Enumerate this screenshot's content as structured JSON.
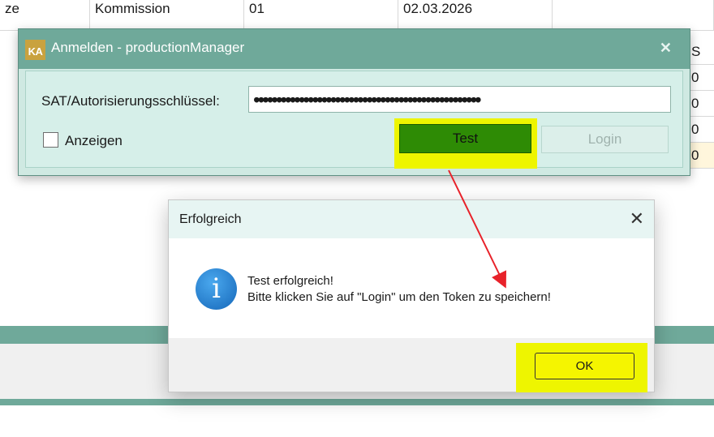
{
  "background_table": {
    "top_row": [
      "ze",
      "Kommission",
      "01",
      "02.03.2026",
      ""
    ],
    "side_cells": [
      "S",
      "0",
      "0",
      "0",
      "0"
    ]
  },
  "login_window": {
    "logo_text": "KA",
    "title": "Anmelden - productionManager",
    "close_glyph": "✕",
    "key_label": "SAT/Autorisierungsschlüssel:",
    "key_value": "●●●●●●●●●●●●●●●●●●●●●●●●●●●●●●●●●●●●●●●●●●●●●●●●●●",
    "show_label": "Anzeigen",
    "test_button": "Test",
    "login_button": "Login",
    "show_checked": false
  },
  "dialog": {
    "title": "Erfolgreich",
    "close_glyph": "✕",
    "icon": "info-icon",
    "icon_glyph": "i",
    "message_line1": "Test erfolgreich!",
    "message_line2": "Bitte klicken Sie auf \"Login\" um den Token zu speichern!",
    "ok_button": "OK"
  },
  "colors": {
    "window_title_bar": "#6fa99a",
    "window_body": "#d6efe9",
    "test_button": "#2e8b05",
    "highlight": "#eef500",
    "annotation_arrow": "#e8222a",
    "dialog_title_bar": "#e7f5f3"
  }
}
